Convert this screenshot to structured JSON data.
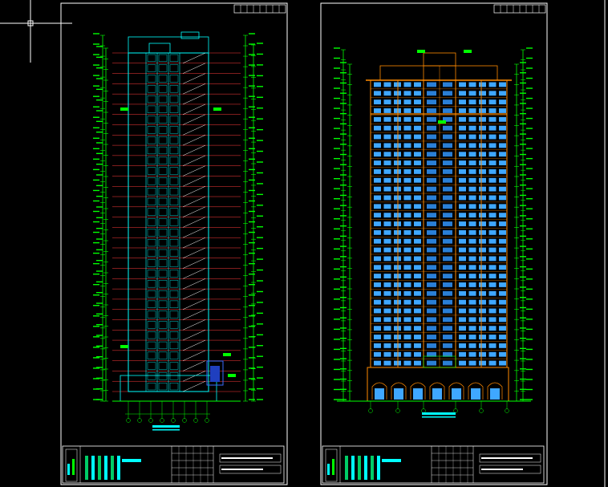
{
  "colors": {
    "background": "#000000",
    "sheet_border": "#ffffff",
    "dimension": "#00ff00",
    "section_lines": "#00ffff",
    "stairs": "#ff3b3b",
    "elevation_frame": "#ff8a00",
    "facade_window": "#3fa7ff",
    "cursor": "#ffffff"
  },
  "drawing": {
    "left_sheet": {
      "view": "section",
      "floors": 33
    },
    "right_sheet": {
      "view": "elevation",
      "floors": 33,
      "window_columns": 10
    }
  }
}
